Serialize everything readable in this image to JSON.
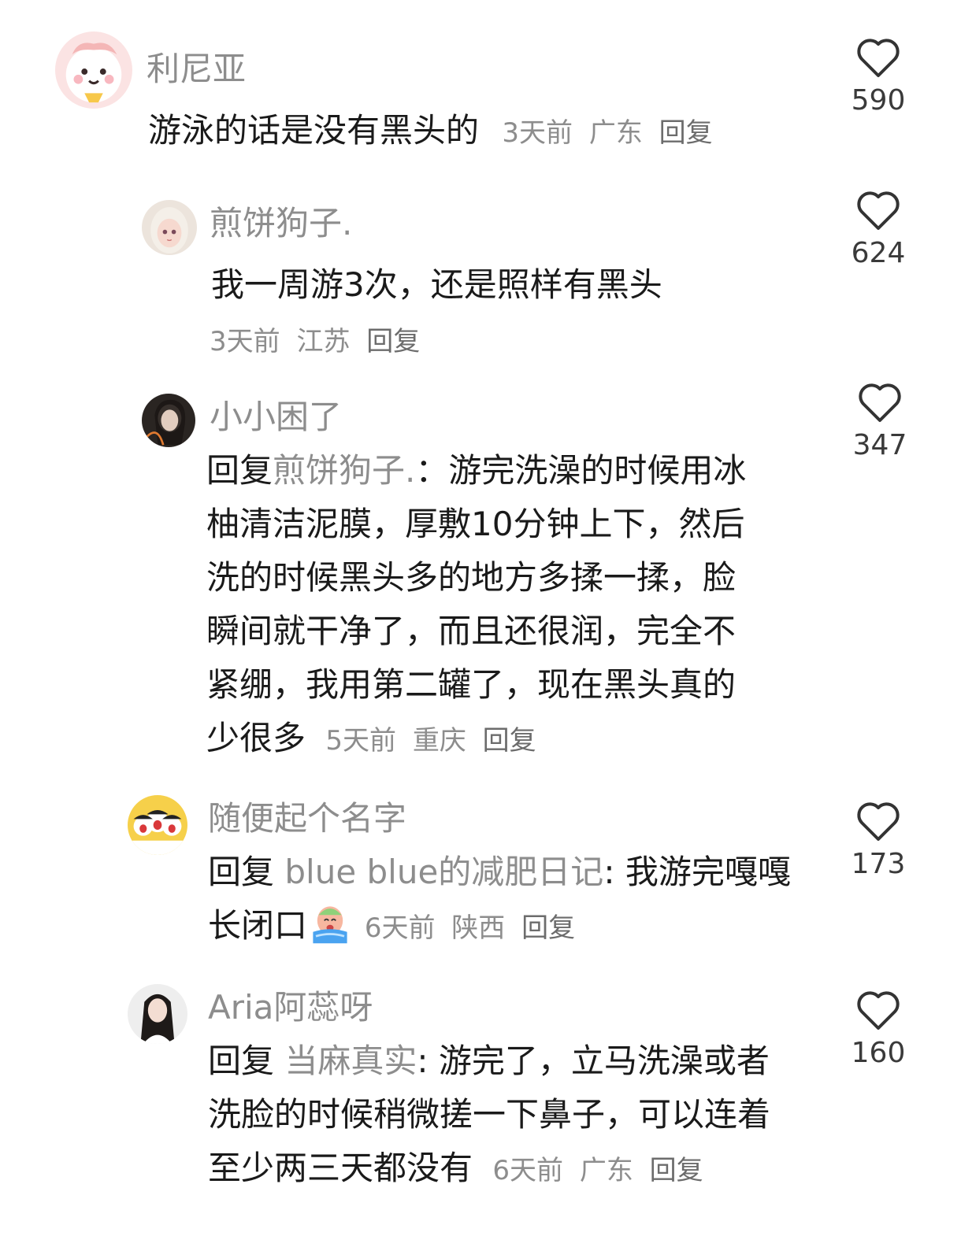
{
  "comments": [
    {
      "username": "利尼亚",
      "text": "游泳的话是没有黑头的",
      "time": "3天前",
      "location": "广东",
      "reply_label": "回复",
      "likes": "590"
    },
    {
      "username": "煎饼狗子.",
      "text": "我一周游3次，还是照样有黑头",
      "time": "3天前",
      "location": "江苏",
      "reply_label": "回复",
      "likes": "624"
    },
    {
      "username": "小小困了",
      "reply_prefix": "回复",
      "mention": "煎饼狗子.",
      "separator": "：",
      "text_lines": [
        "游完洗澡的时候用冰",
        "柚清洁泥膜，厚敷10分钟上下，然后",
        "洗的时候黑头多的地方多揉一揉，脸",
        "瞬间就干净了，而且还很润，完全不",
        "紧绷，我用第二罐了，现在黑头真的",
        "少很多"
      ],
      "time": "5天前",
      "location": "重庆",
      "reply_label": "回复",
      "likes": "347"
    },
    {
      "username": "随便起个名字",
      "reply_prefix": "回复",
      "mention": "blue blue的减肥日记",
      "separator": ": ",
      "text_lines": [
        "我游完嘎嘎",
        "长闭口"
      ],
      "emoji": "crying-face-emoji",
      "time": "6天前",
      "location": "陕西",
      "reply_label": "回复",
      "likes": "173"
    },
    {
      "username": "Aria阿蕊呀",
      "reply_prefix": "回复",
      "mention": "当麻真实",
      "separator": ": ",
      "text_lines": [
        "游完了，立马洗澡或者",
        "洗脸的时候稍微搓一下鼻子，可以连着",
        "至少两三天都没有"
      ],
      "time": "6天前",
      "location": "广东",
      "reply_label": "回复",
      "likes": "160"
    }
  ],
  "icons": {
    "like": "heart-outline-icon"
  },
  "colors": {
    "meta": "#8d8d8d",
    "text": "#1a1a1a",
    "background": "#ffffff"
  }
}
